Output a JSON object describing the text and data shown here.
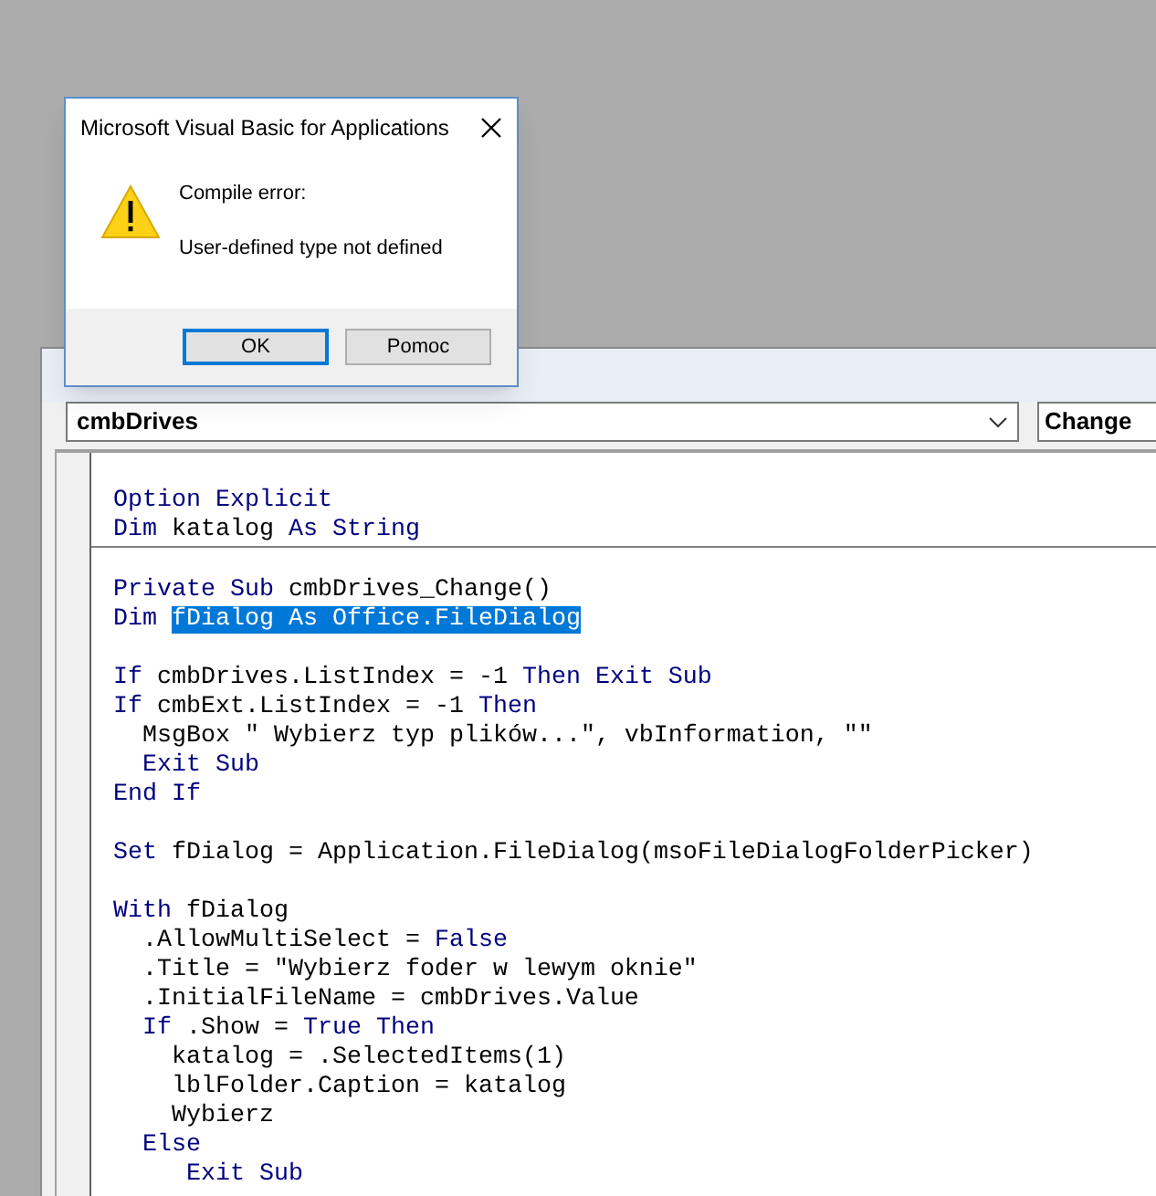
{
  "editor": {
    "object_combo": {
      "value": "cmbDrives"
    },
    "procedure_combo": {
      "value": "Change"
    },
    "sections": [
      {
        "lines": [
          {
            "kind": "blank"
          },
          {
            "kind": "code",
            "segments": [
              {
                "text": "Option Explicit",
                "kind": "keyword"
              }
            ]
          },
          {
            "kind": "code",
            "segments": [
              {
                "text": "Dim",
                "kind": "keyword"
              },
              {
                "text": " katalog ",
                "kind": "plain"
              },
              {
                "text": "As String",
                "kind": "keyword"
              }
            ]
          }
        ]
      },
      {
        "lines": [
          {
            "kind": "blank"
          },
          {
            "kind": "code",
            "segments": [
              {
                "text": "Private Sub",
                "kind": "keyword"
              },
              {
                "text": " cmbDrives_Change()",
                "kind": "plain"
              }
            ]
          },
          {
            "kind": "code",
            "segments": [
              {
                "text": "Dim ",
                "kind": "keyword"
              },
              {
                "text": "fDialog As Office.FileDialog",
                "kind": "selected"
              }
            ]
          },
          {
            "kind": "blank"
          },
          {
            "kind": "code",
            "segments": [
              {
                "text": "If",
                "kind": "keyword"
              },
              {
                "text": " cmbDrives.ListIndex = -1 ",
                "kind": "plain"
              },
              {
                "text": "Then Exit Sub",
                "kind": "keyword"
              }
            ]
          },
          {
            "kind": "code",
            "segments": [
              {
                "text": "If",
                "kind": "keyword"
              },
              {
                "text": " cmbExt.ListIndex = -1 ",
                "kind": "plain"
              },
              {
                "text": "Then",
                "kind": "keyword"
              }
            ]
          },
          {
            "kind": "code",
            "segments": [
              {
                "text": "  MsgBox \" Wybierz typ plików...\", vbInformation, \"\"",
                "kind": "plain"
              }
            ]
          },
          {
            "kind": "code",
            "segments": [
              {
                "text": "  Exit Sub",
                "kind": "keyword"
              }
            ]
          },
          {
            "kind": "code",
            "segments": [
              {
                "text": "End If",
                "kind": "keyword"
              }
            ]
          },
          {
            "kind": "blank"
          },
          {
            "kind": "code",
            "segments": [
              {
                "text": "Set",
                "kind": "keyword"
              },
              {
                "text": " fDialog = Application.FileDialog(msoFileDialogFolderPicker)",
                "kind": "plain"
              }
            ]
          },
          {
            "kind": "blank"
          },
          {
            "kind": "code",
            "segments": [
              {
                "text": "With",
                "kind": "keyword"
              },
              {
                "text": " fDialog",
                "kind": "plain"
              }
            ]
          },
          {
            "kind": "code",
            "segments": [
              {
                "text": "  .AllowMultiSelect = ",
                "kind": "plain"
              },
              {
                "text": "False",
                "kind": "keyword"
              }
            ]
          },
          {
            "kind": "code",
            "segments": [
              {
                "text": "  .Title = \"Wybierz foder w lewym oknie\"",
                "kind": "plain"
              }
            ]
          },
          {
            "kind": "code",
            "segments": [
              {
                "text": "  .InitialFileName = cmbDrives.Value",
                "kind": "plain"
              }
            ]
          },
          {
            "kind": "code",
            "segments": [
              {
                "text": "  If",
                "kind": "keyword"
              },
              {
                "text": " .Show = ",
                "kind": "plain"
              },
              {
                "text": "True Then",
                "kind": "keyword"
              }
            ]
          },
          {
            "kind": "code",
            "segments": [
              {
                "text": "    katalog = .SelectedItems(1)",
                "kind": "plain"
              }
            ]
          },
          {
            "kind": "code",
            "segments": [
              {
                "text": "    lblFolder.Caption = katalog",
                "kind": "plain"
              }
            ]
          },
          {
            "kind": "code",
            "segments": [
              {
                "text": "    Wybierz",
                "kind": "plain"
              }
            ]
          },
          {
            "kind": "code",
            "segments": [
              {
                "text": "  Else",
                "kind": "keyword"
              }
            ]
          },
          {
            "kind": "code",
            "segments": [
              {
                "text": "     Exit Sub",
                "kind": "keyword"
              }
            ]
          }
        ]
      }
    ]
  },
  "dialog": {
    "title": "Microsoft Visual Basic for Applications",
    "heading": "Compile error:",
    "message": "User-defined type not defined",
    "buttons": [
      {
        "label": "OK",
        "selected": true
      },
      {
        "label": "Pomoc",
        "selected": false
      }
    ]
  }
}
